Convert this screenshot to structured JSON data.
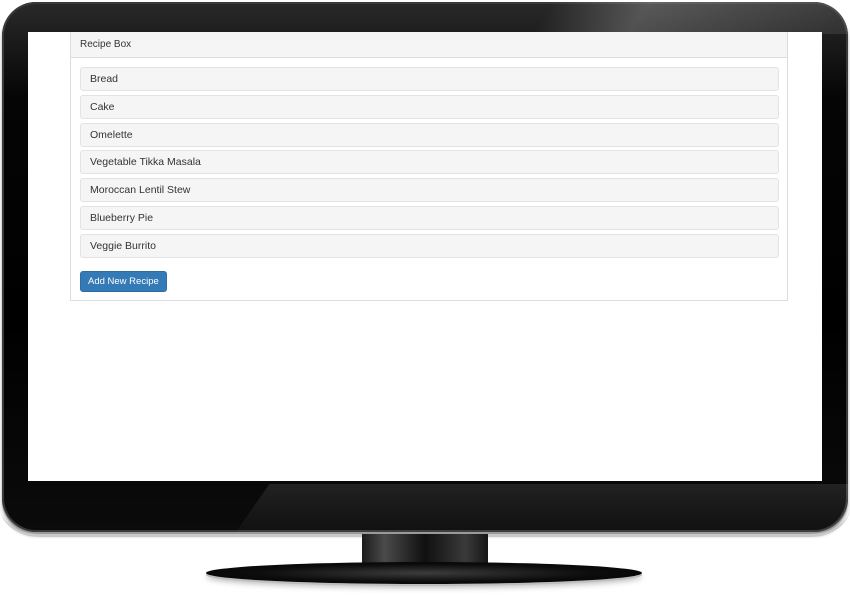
{
  "app": {
    "panel_title": "Recipe Box"
  },
  "recipes": [
    {
      "name": "Bread"
    },
    {
      "name": "Cake"
    },
    {
      "name": "Omelette"
    },
    {
      "name": "Vegetable Tikka Masala"
    },
    {
      "name": "Moroccan Lentil Stew"
    },
    {
      "name": "Blueberry Pie"
    },
    {
      "name": "Veggie Burrito"
    }
  ],
  "actions": {
    "add_label": "Add New Recipe"
  },
  "colors": {
    "primary": "#337ab7",
    "panel_heading_bg": "#f5f5f5",
    "list_item_bg": "#f5f5f5",
    "border": "#dddddd",
    "monitor_frame": "#000000"
  }
}
